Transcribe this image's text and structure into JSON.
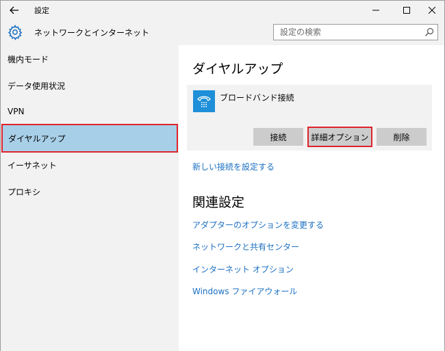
{
  "window": {
    "title": "設定"
  },
  "header": {
    "title": "ネットワークとインターネット",
    "search_placeholder": "設定の検索"
  },
  "sidebar": {
    "items": [
      {
        "label": "機内モード"
      },
      {
        "label": "データ使用状況"
      },
      {
        "label": "VPN"
      },
      {
        "label": "ダイヤルアップ",
        "selected": true
      },
      {
        "label": "イーサネット"
      },
      {
        "label": "プロキシ"
      }
    ]
  },
  "main": {
    "section_title": "ダイヤルアップ",
    "connection": {
      "name": "ブロードバンド接続",
      "icon": "dialup-phone-icon",
      "buttons": {
        "connect": "接続",
        "advanced": "詳細オプション",
        "delete": "削除"
      }
    },
    "new_connection_link": "新しい接続を設定する",
    "related_title": "関連設定",
    "related_links": [
      "アダプターのオプションを変更する",
      "ネットワークと共有センター",
      "インターネット オプション",
      "Windows ファイアウォール"
    ]
  },
  "colors": {
    "accent": "#1e8fd8",
    "link": "#1a6fc2",
    "selected_bg": "#a8cfe8",
    "highlight_border": "#e0222a"
  }
}
